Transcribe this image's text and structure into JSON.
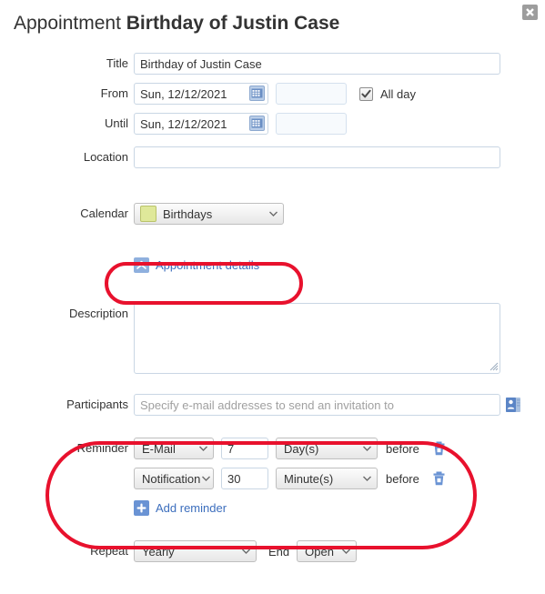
{
  "header": {
    "title_prefix": "Appointment",
    "title_name": "Birthday of Justin Case",
    "close_icon": "close-icon"
  },
  "form": {
    "title": {
      "label": "Title",
      "value": "Birthday of Justin Case",
      "placeholder": ""
    },
    "from": {
      "label": "From",
      "date_value": "Sun, 12/12/2021",
      "time_value": "",
      "time_placeholder": "",
      "calendar_icon": "calendar-icon"
    },
    "until": {
      "label": "Until",
      "date_value": "Sun, 12/12/2021",
      "time_value": "",
      "time_placeholder": "",
      "calendar_icon": "calendar-icon"
    },
    "all_day": {
      "label": "All day",
      "checked": true
    },
    "location": {
      "label": "Location",
      "value": "",
      "placeholder": ""
    },
    "calendar": {
      "label": "Calendar",
      "selected": "Birthdays",
      "swatch_color": "#dfe89a",
      "options": [
        "Birthdays"
      ]
    },
    "details_toggle": {
      "label": "Appointment details",
      "icon": "chevron-double-up-icon"
    },
    "description": {
      "label": "Description",
      "value": "",
      "placeholder": ""
    },
    "participants": {
      "label": "Participants",
      "value": "",
      "placeholder": "Specify e-mail addresses to send an invitation to",
      "picker_icon": "contacts-icon"
    },
    "reminder": {
      "label": "Reminder",
      "before_label": "before",
      "delete_icon": "trash-icon",
      "rows": [
        {
          "type": "E-Mail",
          "amount": "7",
          "unit": "Day(s)"
        },
        {
          "type": "Notification",
          "amount": "30",
          "unit": "Minute(s)"
        }
      ],
      "add_label": "Add reminder",
      "add_icon": "plus-icon"
    },
    "repeat": {
      "label": "Repeat",
      "selected": "Yearly",
      "options": [
        "Yearly"
      ]
    },
    "end": {
      "label": "End",
      "selected": "Open",
      "options": [
        "Open"
      ]
    }
  },
  "annotations": {
    "color": "#e8112d",
    "shapes": [
      {
        "name": "details-toggle-highlight"
      },
      {
        "name": "reminder-section-highlight"
      }
    ]
  }
}
